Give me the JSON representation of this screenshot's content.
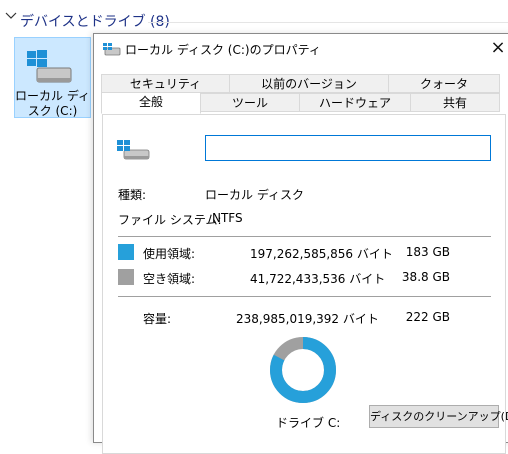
{
  "explorer": {
    "group_title": "デバイスとドライブ (8)",
    "drive_label": "ローカル ディ\nスク (C:)"
  },
  "dialog": {
    "title": "ローカル ディスク (C:)のプロパティ",
    "close": "×",
    "tabs_top": [
      "セキュリティ",
      "以前のバージョン",
      "クォータ"
    ],
    "tabs_bottom": [
      "全般",
      "ツール",
      "ハードウェア",
      "共有"
    ],
    "active_tab": "全般",
    "name_value": "",
    "type_label": "種類:",
    "type_value": "ローカル ディスク",
    "fs_label": "ファイル システム:",
    "fs_value": "NTFS",
    "used_label": "使用領域:",
    "used_bytes": "197,262,585,856 バイト",
    "used_gb": "183 GB",
    "free_label": "空き領域:",
    "free_bytes": "41,722,433,536 バイト",
    "free_gb": "38.8 GB",
    "capacity_label": "容量:",
    "capacity_bytes": "238,985,019,392 バイト",
    "capacity_gb": "222 GB",
    "drive_caption": "ドライブ C:",
    "cleanup_button": "ディスクのクリーンアップ(D)",
    "used_fraction": 0.825,
    "colors": {
      "used": "#26a0da",
      "free": "#a0a0a0",
      "accent": "#0078d7"
    }
  }
}
